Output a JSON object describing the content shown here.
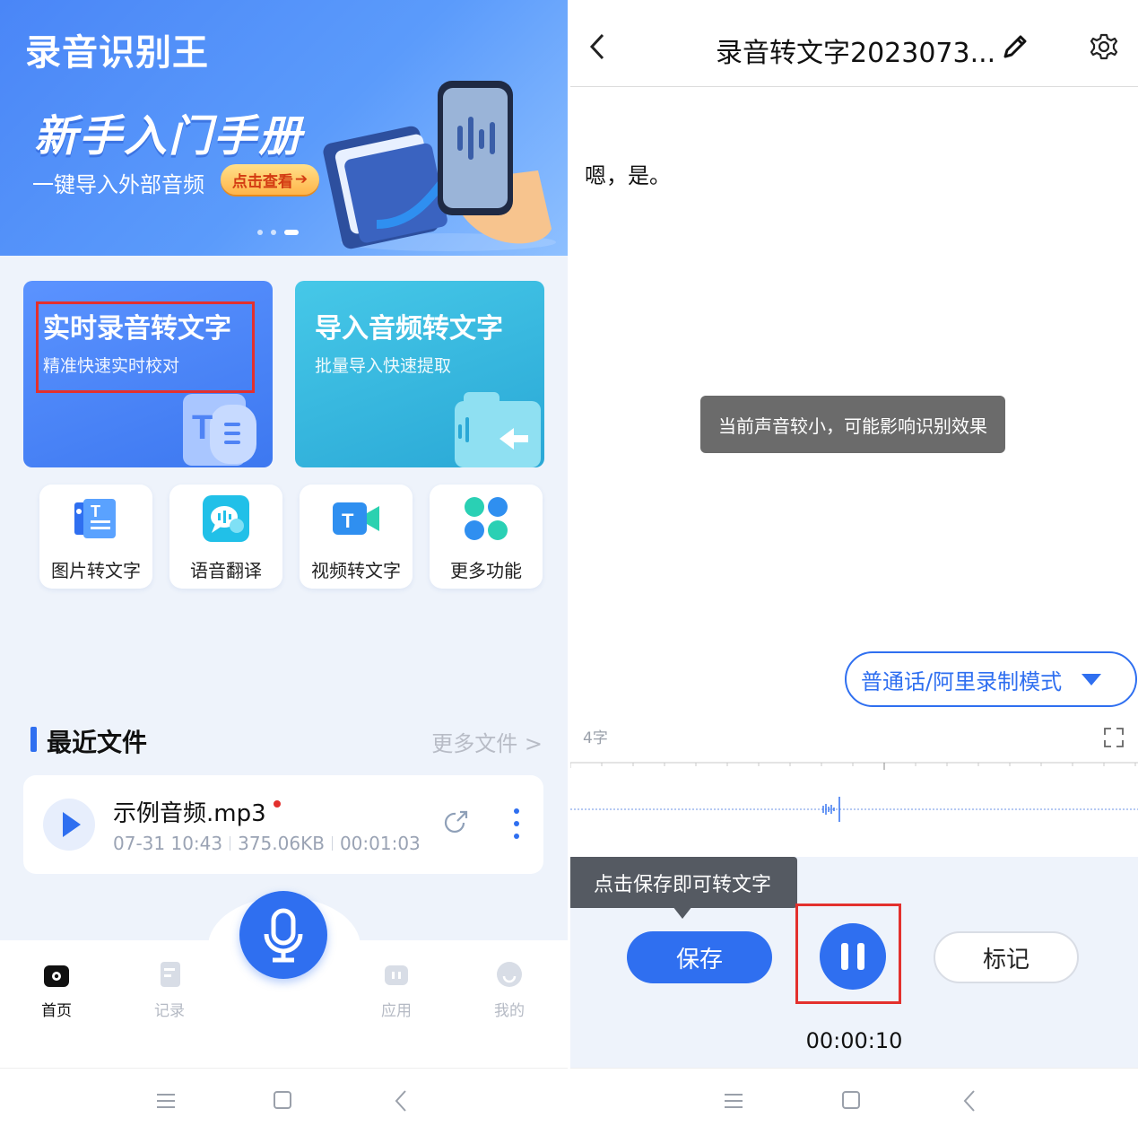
{
  "left": {
    "app_title": "录音识别王",
    "banner": {
      "headline": "新手入门手册",
      "subtitle": "一键导入外部音频",
      "cta": "点击查看",
      "slide_count": 3,
      "active_slide": 3
    },
    "cards": [
      {
        "title": "实时录音转文字",
        "subtitle": "精准快速实时校对"
      },
      {
        "title": "导入音频转文字",
        "subtitle": "批量导入快速提取"
      }
    ],
    "features": [
      {
        "label": "图片转文字",
        "icon": "image-to-text-icon"
      },
      {
        "label": "语音翻译",
        "icon": "voice-translate-icon"
      },
      {
        "label": "视频转文字",
        "icon": "video-to-text-icon"
      },
      {
        "label": "更多功能",
        "icon": "more-features-icon"
      }
    ],
    "recent": {
      "title": "最近文件",
      "more": "更多文件 >",
      "files": [
        {
          "name": "示例音频.mp3",
          "date": "07-31 10:43",
          "size": "375.06KB",
          "duration": "00:01:03"
        }
      ]
    },
    "nav": {
      "items": [
        {
          "label": "首页",
          "icon": "home-icon",
          "active": true
        },
        {
          "label": "记录",
          "icon": "records-icon",
          "active": false
        },
        {
          "label": "应用",
          "icon": "apps-icon",
          "active": false
        },
        {
          "label": "我的",
          "icon": "profile-icon",
          "active": false
        }
      ]
    }
  },
  "right": {
    "title": "录音转文字2023073...",
    "transcript": "嗯，是。",
    "toast": "当前声音较小，可能影响识别效果",
    "mode": "普通话/阿里录制模式",
    "word_count": "4字",
    "tooltip": "点击保存即可转文字",
    "save": "保存",
    "mark": "标记",
    "timer": "00:00:10"
  },
  "colors": {
    "accent": "#2f6ff0",
    "highlight_box": "#e3302d"
  }
}
